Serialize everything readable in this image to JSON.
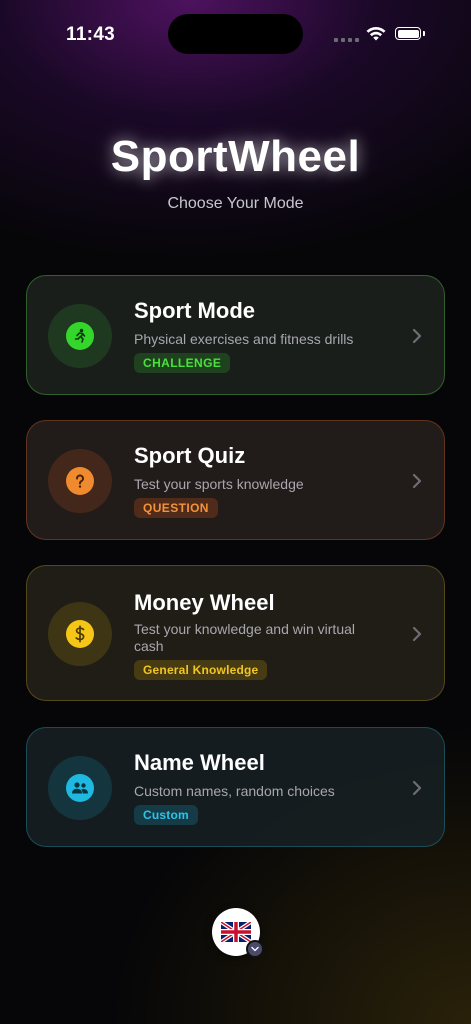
{
  "status_bar": {
    "time": "11:43",
    "icons": [
      "cellular-signal-icon",
      "wifi-icon",
      "battery-icon"
    ]
  },
  "header": {
    "title": "SportWheel",
    "subtitle": "Choose Your Mode"
  },
  "modes": [
    {
      "title": "Sport Mode",
      "description": "Physical exercises and fitness drills",
      "badge": "CHALLENGE",
      "icon": "running-person-icon",
      "accent": "#35d62b"
    },
    {
      "title": "Sport Quiz",
      "description": "Test your sports knowledge",
      "badge": "QUESTION",
      "icon": "question-mark-icon",
      "accent": "#f08a2e"
    },
    {
      "title": "Money Wheel",
      "description": "Test your knowledge and win virtual cash",
      "badge": "General Knowledge",
      "icon": "dollar-icon",
      "accent": "#f5c518"
    },
    {
      "title": "Name Wheel",
      "description": "Custom names, random choices",
      "badge": "Custom",
      "icon": "people-icon",
      "accent": "#1fb8e0"
    }
  ],
  "language_selector": {
    "flag": "uk-flag-icon",
    "icon": "chevron-down-icon"
  }
}
